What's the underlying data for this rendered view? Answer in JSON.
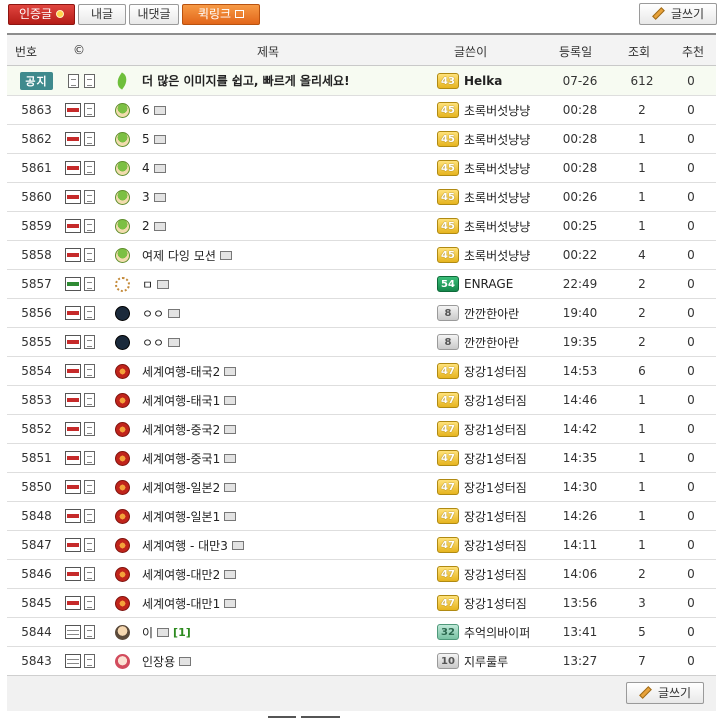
{
  "toolbar": {
    "certified_label": "인증글",
    "my_posts_label": "내글",
    "my_comments_label": "내댓글",
    "quicklink_label": "퀵링크",
    "write_label": "글쓰기"
  },
  "columns": {
    "num": "번호",
    "copyright": "©",
    "title": "제목",
    "author": "글쓴이",
    "date": "등록일",
    "views": "조회",
    "recommend": "추천"
  },
  "notice": {
    "badge": "공지",
    "title": "더 많은 이미지를 쉽고, 빠르게 올리세요!",
    "level": "43",
    "author": "Helka",
    "date": "07-26",
    "views": "612",
    "recommend": "0",
    "avatar_icon": "feather-icon"
  },
  "rows": [
    {
      "num": "5863",
      "fmt": "PNG",
      "avatar": "mush",
      "title": "6",
      "level": "45",
      "level_color": "gold",
      "author": "초록버섯냥냥",
      "date": "00:28",
      "views": "2",
      "recommend": "0"
    },
    {
      "num": "5862",
      "fmt": "PNG",
      "avatar": "mush",
      "title": "5",
      "level": "45",
      "level_color": "gold",
      "author": "초록버섯냥냥",
      "date": "00:28",
      "views": "1",
      "recommend": "0"
    },
    {
      "num": "5861",
      "fmt": "PNG",
      "avatar": "mush",
      "title": "4",
      "level": "45",
      "level_color": "gold",
      "author": "초록버섯냥냥",
      "date": "00:28",
      "views": "1",
      "recommend": "0"
    },
    {
      "num": "5860",
      "fmt": "PNG",
      "avatar": "mush",
      "title": "3",
      "level": "45",
      "level_color": "gold",
      "author": "초록버섯냥냥",
      "date": "00:26",
      "views": "1",
      "recommend": "0"
    },
    {
      "num": "5859",
      "fmt": "PNG",
      "avatar": "mush",
      "title": "2",
      "level": "45",
      "level_color": "gold",
      "author": "초록버섯냥냥",
      "date": "00:25",
      "views": "1",
      "recommend": "0"
    },
    {
      "num": "5858",
      "fmt": "PNG",
      "avatar": "mush",
      "title": "여제 다잉 모션",
      "level": "45",
      "level_color": "gold",
      "author": "초록버섯냥냥",
      "date": "00:22",
      "views": "4",
      "recommend": "0"
    },
    {
      "num": "5857",
      "fmt": "GIF",
      "avatar": "gear",
      "title": "ㅁ",
      "level": "54",
      "level_color": "green",
      "author": "ENRAGE",
      "date": "22:49",
      "views": "2",
      "recommend": "0"
    },
    {
      "num": "5856",
      "fmt": "PNG",
      "avatar": "zz",
      "title": "ㅇㅇ",
      "level": "8",
      "level_color": "silver",
      "author": "깐깐한아란",
      "date": "19:40",
      "views": "2",
      "recommend": "0"
    },
    {
      "num": "5855",
      "fmt": "PNG",
      "avatar": "zz",
      "title": "ㅇㅇ",
      "level": "8",
      "level_color": "silver",
      "author": "깐깐한아란",
      "date": "19:35",
      "views": "2",
      "recommend": "0"
    },
    {
      "num": "5854",
      "fmt": "PNG",
      "avatar": "fire",
      "title": "세계여행-태국2",
      "level": "47",
      "level_color": "gold",
      "author": "장강1성터짐",
      "date": "14:53",
      "views": "6",
      "recommend": "0"
    },
    {
      "num": "5853",
      "fmt": "PNG",
      "avatar": "fire",
      "title": "세계여행-태국1",
      "level": "47",
      "level_color": "gold",
      "author": "장강1성터짐",
      "date": "14:46",
      "views": "1",
      "recommend": "0"
    },
    {
      "num": "5852",
      "fmt": "PNG",
      "avatar": "fire",
      "title": "세계여행-중국2",
      "level": "47",
      "level_color": "gold",
      "author": "장강1성터짐",
      "date": "14:42",
      "views": "1",
      "recommend": "0"
    },
    {
      "num": "5851",
      "fmt": "PNG",
      "avatar": "fire",
      "title": "세계여행-중국1",
      "level": "47",
      "level_color": "gold",
      "author": "장강1성터짐",
      "date": "14:35",
      "views": "1",
      "recommend": "0"
    },
    {
      "num": "5850",
      "fmt": "PNG",
      "avatar": "fire",
      "title": "세계여행-일본2",
      "level": "47",
      "level_color": "gold",
      "author": "장강1성터짐",
      "date": "14:30",
      "views": "1",
      "recommend": "0"
    },
    {
      "num": "5848",
      "fmt": "PNG",
      "avatar": "fire",
      "title": "세계여행-일본1",
      "level": "47",
      "level_color": "gold",
      "author": "장강1성터짐",
      "date": "14:26",
      "views": "1",
      "recommend": "0"
    },
    {
      "num": "5847",
      "fmt": "PNG",
      "avatar": "fire",
      "title": "세계여행 - 대만3",
      "level": "47",
      "level_color": "gold",
      "author": "장강1성터짐",
      "date": "14:11",
      "views": "1",
      "recommend": "0"
    },
    {
      "num": "5846",
      "fmt": "PNG",
      "avatar": "fire",
      "title": "세계여행-대만2",
      "level": "47",
      "level_color": "gold",
      "author": "장강1성터짐",
      "date": "14:06",
      "views": "2",
      "recommend": "0"
    },
    {
      "num": "5845",
      "fmt": "PNG",
      "avatar": "fire",
      "title": "세계여행-대만1",
      "level": "47",
      "level_color": "gold",
      "author": "장강1성터짐",
      "date": "13:56",
      "views": "3",
      "recommend": "0"
    },
    {
      "num": "5844",
      "fmt": "JPG",
      "avatar": "pet",
      "title": "이",
      "comments": "[1]",
      "level": "32",
      "level_color": "teal",
      "author": "추억의바이퍼",
      "date": "13:41",
      "views": "5",
      "recommend": "0"
    },
    {
      "num": "5843",
      "fmt": "JPG",
      "avatar": "doll",
      "title": "인장용",
      "level": "10",
      "level_color": "silver",
      "author": "지루룰루",
      "date": "13:27",
      "views": "7",
      "recommend": "0"
    }
  ]
}
